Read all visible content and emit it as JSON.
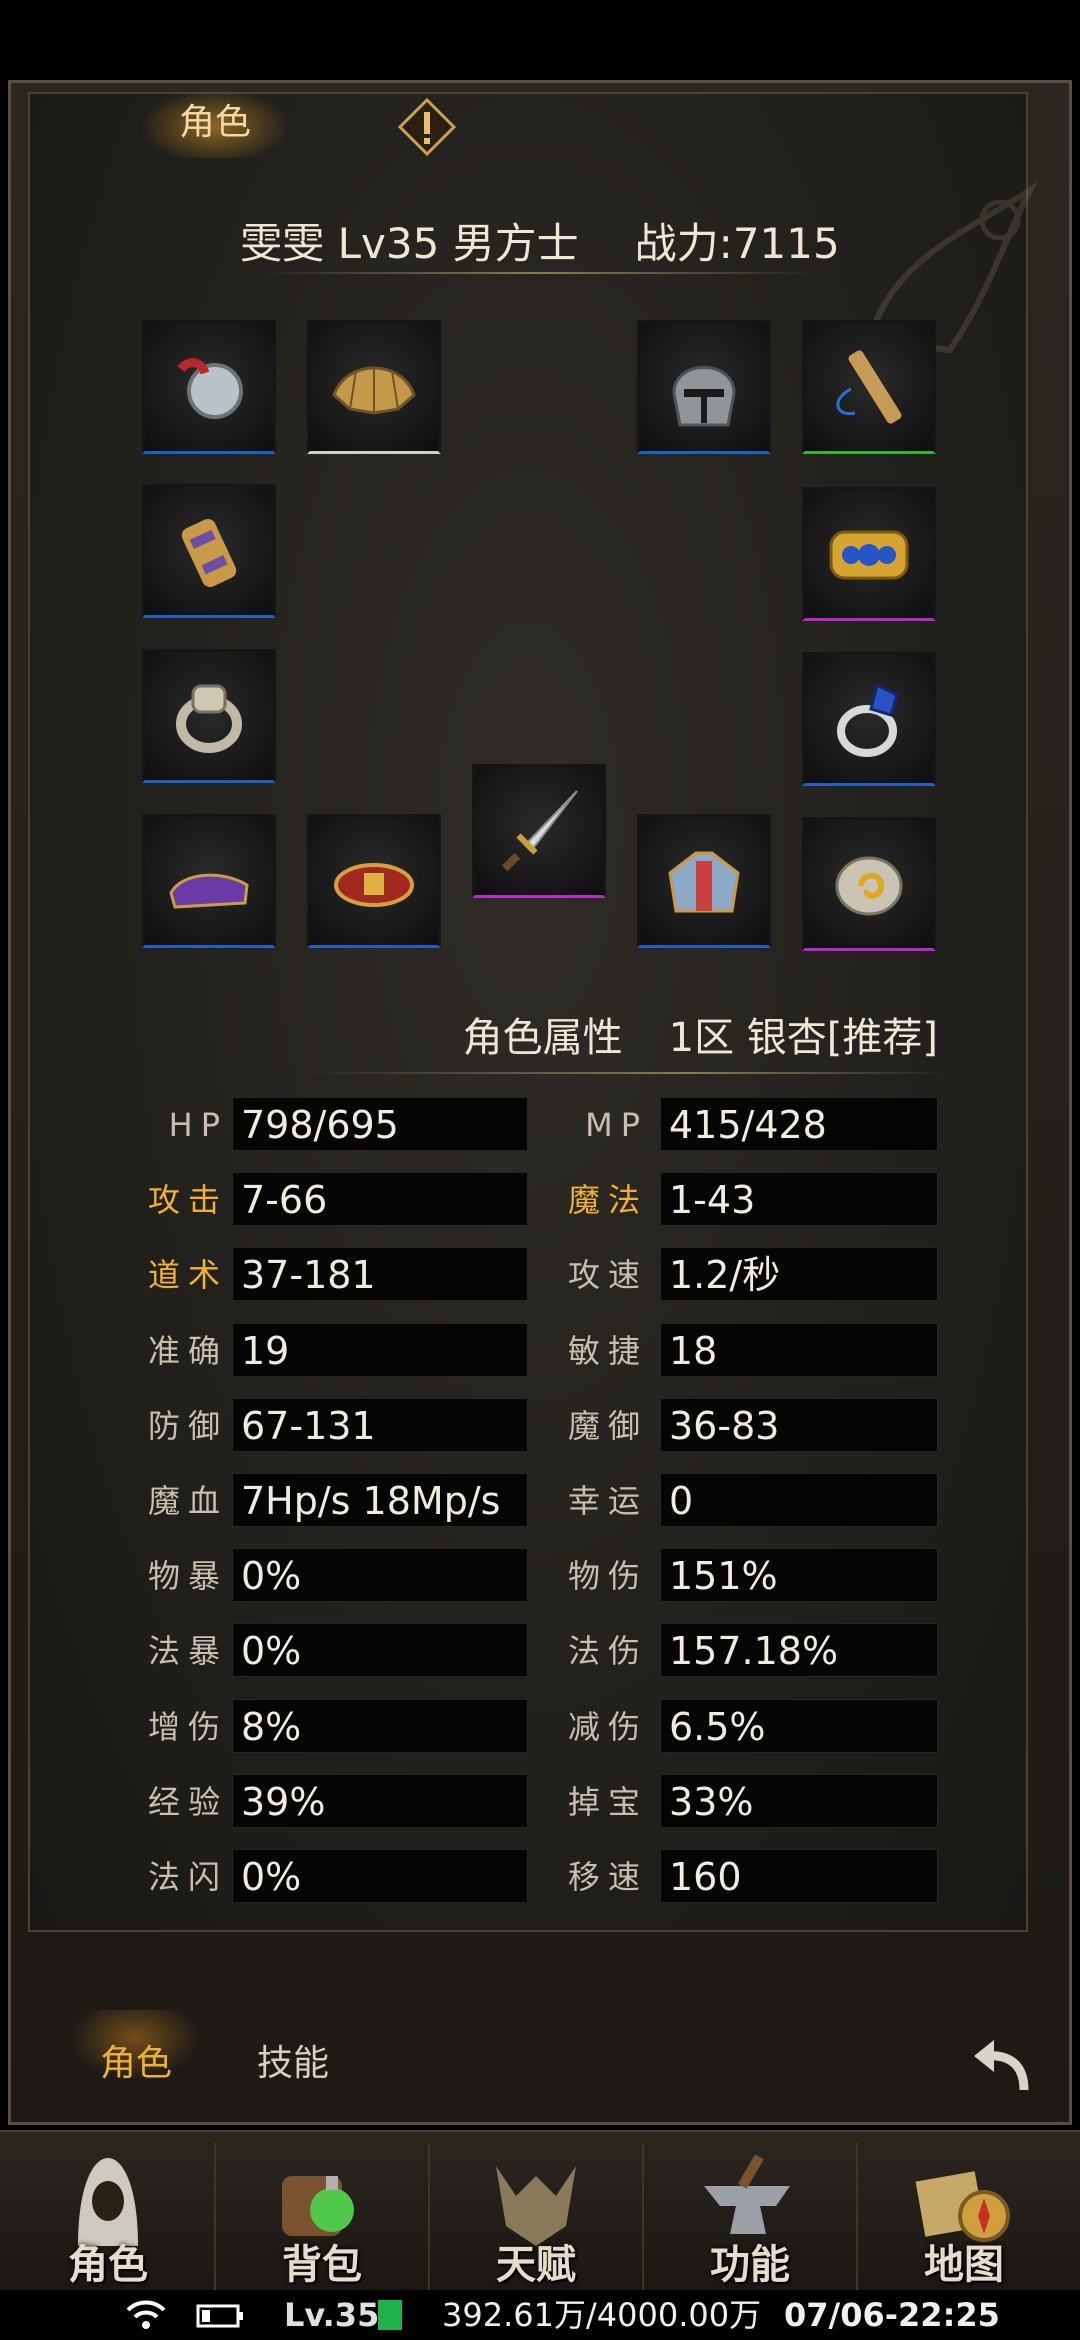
{
  "top_tab": {
    "label": "角色"
  },
  "character": {
    "name_line": "雯雯 Lv35 男方士",
    "power": "战力:7115"
  },
  "equipment_slots": [
    {
      "name": "amulet-slot",
      "quality": "blue",
      "icon": "medal-icon"
    },
    {
      "name": "shoulder-slot",
      "quality": "white",
      "icon": "fan-icon"
    },
    {
      "name": "helmet-slot",
      "quality": "blue",
      "icon": "helmet-icon"
    },
    {
      "name": "charm-slot",
      "quality": "green",
      "icon": "flute-icon"
    },
    {
      "name": "bracer-left-slot",
      "quality": "blue",
      "icon": "bracer-icon"
    },
    {
      "name": "bracer-right-slot",
      "quality": "purple",
      "icon": "bracelet-icon"
    },
    {
      "name": "ring-left-slot",
      "quality": "blue",
      "icon": "ring-icon"
    },
    {
      "name": "ring-right-slot",
      "quality": "blue",
      "icon": "gem-ring-icon"
    },
    {
      "name": "boots-slot",
      "quality": "blue",
      "icon": "boots-icon"
    },
    {
      "name": "belt-slot",
      "quality": "blue",
      "icon": "belt-icon"
    },
    {
      "name": "weapon-slot",
      "quality": "purple",
      "icon": "sword-icon"
    },
    {
      "name": "armor-slot",
      "quality": "blue",
      "icon": "armor-icon"
    },
    {
      "name": "talisman-slot",
      "quality": "purple",
      "icon": "talisman-icon"
    }
  ],
  "attributes": {
    "title": "角色属性",
    "server": "1区 银杏[推荐]",
    "rows": [
      [
        {
          "label": "HP",
          "value": "798/695",
          "highlight": false
        },
        {
          "label": "MP",
          "value": "415/428",
          "highlight": false
        }
      ],
      [
        {
          "label": "攻击",
          "value": "7-66",
          "highlight": true
        },
        {
          "label": "魔法",
          "value": "1-43",
          "highlight": true
        }
      ],
      [
        {
          "label": "道术",
          "value": "37-181",
          "highlight": true
        },
        {
          "label": "攻速",
          "value": "1.2/秒",
          "highlight": false
        }
      ],
      [
        {
          "label": "准确",
          "value": "19",
          "highlight": false
        },
        {
          "label": "敏捷",
          "value": "18",
          "highlight": false
        }
      ],
      [
        {
          "label": "防御",
          "value": "67-131",
          "highlight": false
        },
        {
          "label": "魔御",
          "value": "36-83",
          "highlight": false
        }
      ],
      [
        {
          "label": "魔血",
          "value": "7Hp/s   18Mp/s",
          "highlight": false
        },
        {
          "label": "幸运",
          "value": "0",
          "highlight": false
        }
      ],
      [
        {
          "label": "物暴",
          "value": "0%",
          "highlight": false
        },
        {
          "label": "物伤",
          "value": "151%",
          "highlight": false
        }
      ],
      [
        {
          "label": "法暴",
          "value": "0%",
          "highlight": false
        },
        {
          "label": "法伤",
          "value": "157.18%",
          "highlight": false
        }
      ],
      [
        {
          "label": "增伤",
          "value": "8%",
          "highlight": false
        },
        {
          "label": "减伤",
          "value": "6.5%",
          "highlight": false
        }
      ],
      [
        {
          "label": "经验",
          "value": "39%",
          "highlight": false
        },
        {
          "label": "掉宝",
          "value": "33%",
          "highlight": false
        }
      ],
      [
        {
          "label": "法闪",
          "value": "0%",
          "highlight": false
        },
        {
          "label": "移速",
          "value": "160",
          "highlight": false
        }
      ]
    ]
  },
  "bottom_tabs": [
    "角色",
    "技能"
  ],
  "nav": [
    "角色",
    "背包",
    "天赋",
    "功能",
    "地图"
  ],
  "info_bar": {
    "level": "Lv.35",
    "exp": "392.61万/4000.00万",
    "datetime": "07/06-22:25"
  },
  "colors": {
    "gold": "#f0b030",
    "blue": "#1f5fcc",
    "purple": "#b52bc9",
    "green": "#2fb52f"
  }
}
